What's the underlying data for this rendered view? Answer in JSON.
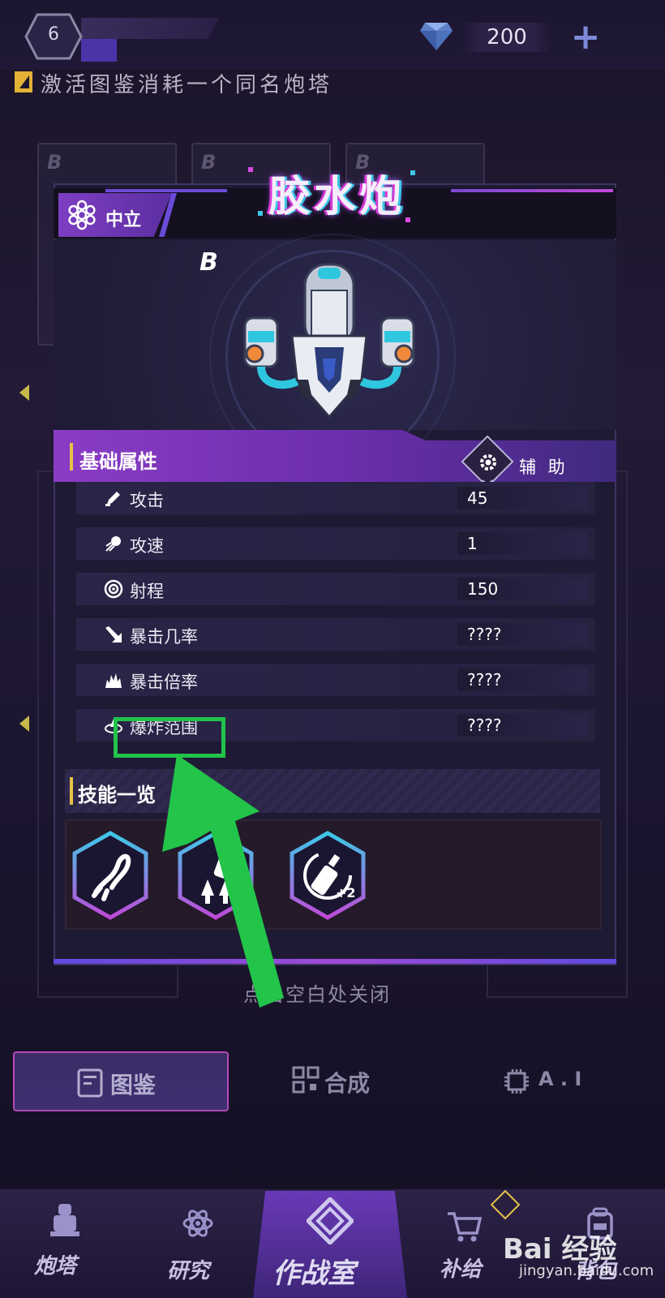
{
  "top": {
    "player_level": "6",
    "gem_count": "200",
    "add_label": "+"
  },
  "hint": "激活图鉴消耗一个同名炮塔",
  "background_cards": [
    "B",
    "B",
    "B"
  ],
  "modal": {
    "faction": "中立",
    "tower_name": "胶水炮",
    "grade": "B",
    "base_stats_title": "基础属性",
    "role": "辅 助",
    "stats": [
      {
        "label": "攻击",
        "value": "45"
      },
      {
        "label": "攻速",
        "value": "1"
      },
      {
        "label": "射程",
        "value": "150"
      },
      {
        "label": "暴击几率",
        "value": "????"
      },
      {
        "label": "暴击倍率",
        "value": "????"
      },
      {
        "label": "爆炸范围",
        "value": "????"
      }
    ],
    "skills_title": "技能一览",
    "skills": [
      "glue-splash-skill",
      "attack-speed-up-skill",
      "glue-bottle-plus2-skill"
    ]
  },
  "close_hint": "点击空白处关闭",
  "tabs": [
    {
      "label": "图鉴",
      "active": true
    },
    {
      "label": "合成",
      "active": false
    },
    {
      "label": "A . I",
      "active": false
    }
  ],
  "nav": [
    {
      "label": "炮塔"
    },
    {
      "label": "研究"
    },
    {
      "label": "作战室"
    },
    {
      "label": "补给"
    },
    {
      "label": "背包"
    }
  ],
  "watermark": {
    "logo": "Bai 经验",
    "url": "jingyan.baidu.com"
  },
  "colors": {
    "accent_purple": "#8a3cc6",
    "highlight_green": "#21c44a",
    "gold": "#e7c24a"
  }
}
